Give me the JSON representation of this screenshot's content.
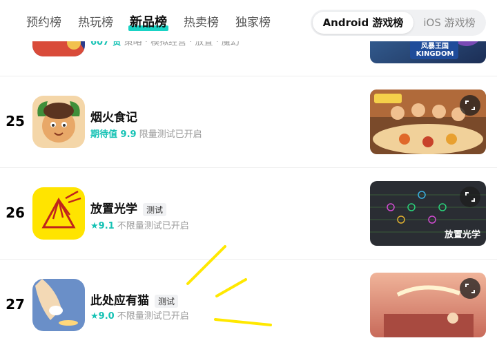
{
  "tabs": [
    {
      "label": "预约榜",
      "active": false
    },
    {
      "label": "热玩榜",
      "active": false
    },
    {
      "label": "新品榜",
      "active": true
    },
    {
      "label": "热卖榜",
      "active": false
    },
    {
      "label": "独家榜",
      "active": false
    }
  ],
  "platform": {
    "android": "Android 游戏榜",
    "ios": "iOS 游戏榜"
  },
  "partial_row": {
    "meta_score": "607 赞",
    "meta_desc": "策略 · 模拟经营 · 放置 · 魔幻",
    "thumb_text": "风暴王国 KINGDOM"
  },
  "rows": [
    {
      "rank": "25",
      "name": "烟火食记",
      "tag": "",
      "score_label": "期待值 9.9",
      "desc": "限量测试已开启",
      "thumb_label": ""
    },
    {
      "rank": "26",
      "name": "放置光学",
      "tag": "测试",
      "score_label": "★9.1",
      "desc": "不限量测试已开启",
      "thumb_label": "放置光学"
    },
    {
      "rank": "27",
      "name": "此处应有猫",
      "tag": "测试",
      "score_label": "★9.0",
      "desc": "不限量测试已开启",
      "thumb_label": ""
    }
  ],
  "colors": {
    "accent": "#19d3c5",
    "score": "#15c2b4",
    "annotation": "#ffe800"
  }
}
